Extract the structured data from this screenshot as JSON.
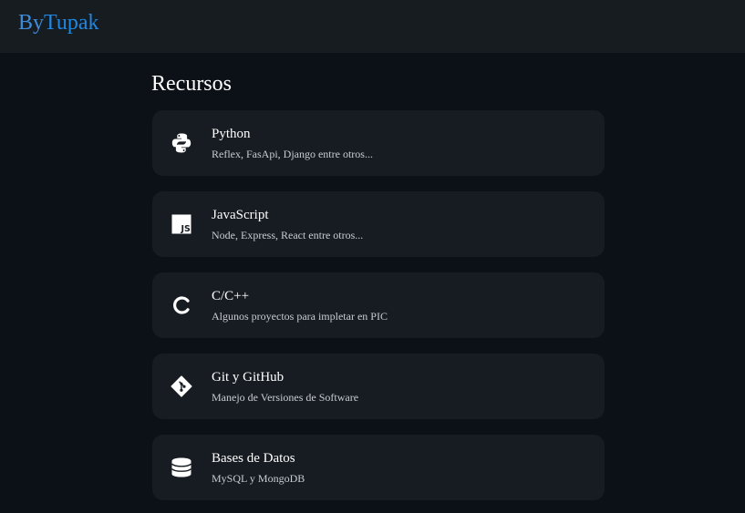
{
  "navbar": {
    "brand_part_1": "By",
    "brand_part_2": "Tupak"
  },
  "main": {
    "title": "Recursos",
    "resources": [
      {
        "title": "Python",
        "description": "Reflex, FasApi, Django entre otros...",
        "icon": "python-icon"
      },
      {
        "title": "JavaScript",
        "description": "Node, Express, React entre otros...",
        "icon": "javascript-icon"
      },
      {
        "title": "C/C++",
        "description": "Algunos proyectos para impletar en PIC",
        "icon": "c-language-icon"
      },
      {
        "title": "Git y GitHub",
        "description": "Manejo de Versiones de Software",
        "icon": "git-icon"
      },
      {
        "title": "Bases de Datos",
        "description": "MySQL y MongoDB",
        "icon": "database-icon"
      }
    ]
  },
  "colors": {
    "page_background": "#0b1117",
    "navbar_background": "#171c21",
    "card_background": "#161c22",
    "brand_accent": "#1e88e5",
    "text_primary": "#ffffff",
    "text_secondary": "#c9cdd2"
  }
}
